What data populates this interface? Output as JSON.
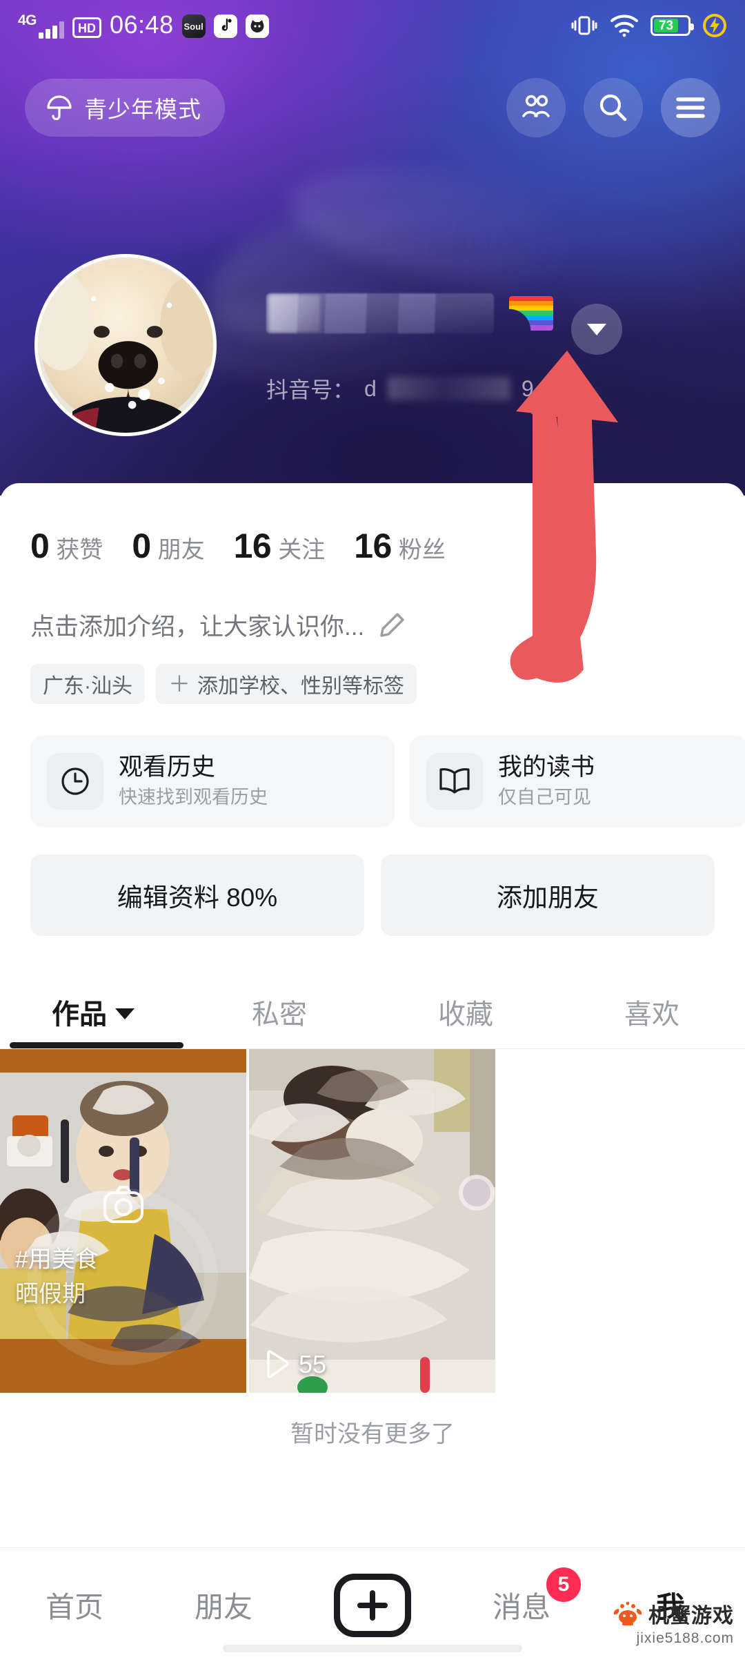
{
  "status_bar": {
    "network_type": "4G",
    "hd_label": "HD",
    "time": "06:48",
    "app_icons": [
      {
        "name": "soul-app-icon",
        "label": "Soul"
      },
      {
        "name": "douyin-app-icon",
        "label": "d"
      },
      {
        "name": "cat-app-icon",
        "label": "ὃ1"
      }
    ],
    "battery_percent": "73",
    "icons_right": [
      "vibrate-icon",
      "wifi-icon",
      "battery-icon",
      "charging-bolt-icon"
    ]
  },
  "header": {
    "teen_mode_label": "青少年模式",
    "teen_mode_icon": "umbrella-icon",
    "actions": [
      {
        "name": "friends-icon",
        "label": "朋友"
      },
      {
        "name": "search-icon",
        "label": "搜索"
      },
      {
        "name": "menu-icon",
        "label": "菜单"
      }
    ]
  },
  "profile": {
    "avatar_alt": "golden-retriever-puppy-in-snow",
    "display_name": "",
    "name_redacted": true,
    "name_emoji": "rainbow-emoji",
    "douyin_id_prefix": "抖音号：",
    "douyin_id_visible_start": "d",
    "douyin_id_visible_end": "9",
    "qr_icon": "qr-code-icon",
    "expand_icon": "chevron-down-icon"
  },
  "annotation": {
    "arrow_color": "#ea5a5c",
    "points_to": "chevron-down-icon"
  },
  "stats": [
    {
      "num": "0",
      "label": "获赞"
    },
    {
      "num": "0",
      "label": "朋友"
    },
    {
      "num": "16",
      "label": "关注"
    },
    {
      "num": "16",
      "label": "粉丝"
    }
  ],
  "bio": {
    "placeholder": "点击添加介绍，让大家认识你...",
    "edit_icon": "pencil-icon"
  },
  "tags": [
    {
      "name": "location-tag",
      "label": "广东·汕头",
      "has_plus": false
    },
    {
      "name": "add-tag",
      "label": "添加学校、性别等标签",
      "has_plus": true,
      "plus": "＋"
    }
  ],
  "feature_cards": [
    {
      "name": "watch-history-card",
      "icon": "clock-icon",
      "title": "观看历史",
      "subtitle": "快速找到观看历史"
    },
    {
      "name": "my-reading-card",
      "icon": "book-icon",
      "title": "我的读书",
      "subtitle": "仅自己可见"
    },
    {
      "name": "my-music-card",
      "icon": "music-note-icon",
      "title": "",
      "subtitle": ""
    }
  ],
  "actions": [
    {
      "name": "edit-profile-button",
      "label": "编辑资料 80%"
    },
    {
      "name": "add-friend-button",
      "label": "添加朋友"
    }
  ],
  "tabs": [
    {
      "name": "tab-works",
      "label": "作品",
      "active": true,
      "has_caret": true
    },
    {
      "name": "tab-private",
      "label": "私密",
      "active": false,
      "has_caret": false
    },
    {
      "name": "tab-collection",
      "label": "收藏",
      "active": false,
      "has_caret": false
    },
    {
      "name": "tab-likes",
      "label": "喜欢",
      "active": false,
      "has_caret": false
    }
  ],
  "videos": [
    {
      "name": "video-thumb-1",
      "caption_line1": "#用美食",
      "caption_line2": "晒假期",
      "overlay_icon": "camera-icon",
      "play_count": ""
    },
    {
      "name": "video-thumb-2",
      "caption_line1": "",
      "caption_line2": "",
      "overlay_icon": "",
      "play_count": "55",
      "play_icon": "play-icon"
    }
  ],
  "footer": {
    "no_more_text": "暂时没有更多了"
  },
  "bottom_nav": [
    {
      "name": "nav-home",
      "label": "首页",
      "active": false,
      "badge": ""
    },
    {
      "name": "nav-friends",
      "label": "朋友",
      "active": false,
      "badge": ""
    },
    {
      "name": "nav-create",
      "label": "",
      "active": false,
      "badge": "",
      "icon": "plus-icon"
    },
    {
      "name": "nav-messages",
      "label": "消息",
      "active": false,
      "badge": "5"
    },
    {
      "name": "nav-me",
      "label": "我",
      "active": true,
      "badge": ""
    }
  ],
  "watermark": {
    "brand": "机蟹游戏",
    "url": "jixie5188.com",
    "logo": "crab-logo-icon",
    "color": "#ee5a1e"
  },
  "colors": {
    "accent_red": "#fe2c55",
    "annotation": "#ea5a5c",
    "battery_green": "#25cc50",
    "card_bg": "#f5f6f7",
    "text_primary": "#17181a",
    "text_secondary": "#8a8d93"
  }
}
